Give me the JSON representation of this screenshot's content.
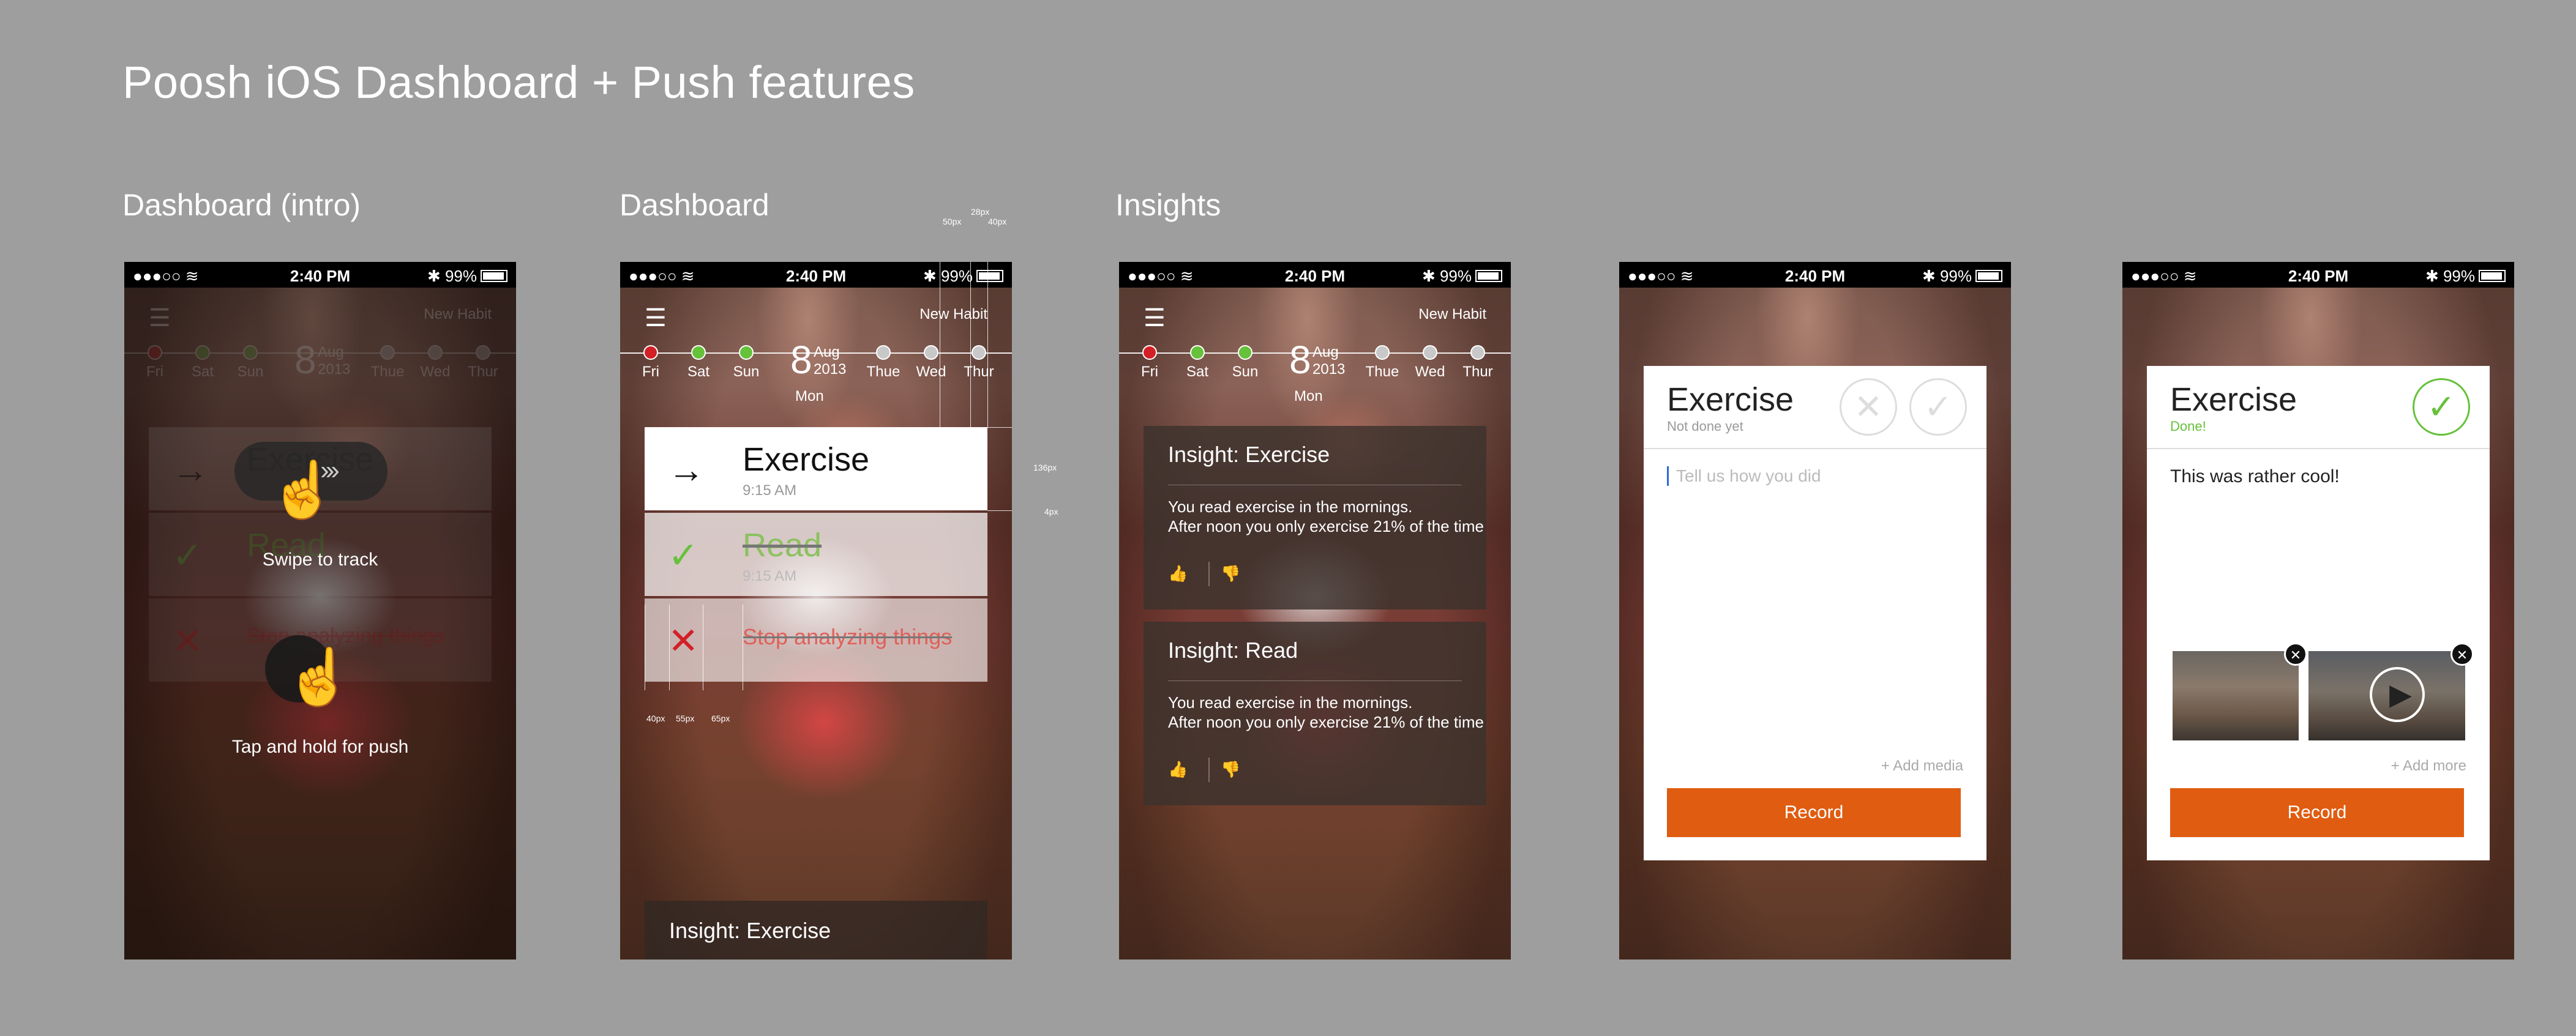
{
  "page": {
    "title": "Poosh iOS Dashboard + Push features"
  },
  "screens": [
    {
      "label": "Dashboard (intro)"
    },
    {
      "label": "Dashboard"
    },
    {
      "label": "Insights"
    },
    {
      "label": ""
    },
    {
      "label": ""
    }
  ],
  "status": {
    "signal": "●●●○○ ≋",
    "time": "2:40 PM",
    "battery": "✱ 99%"
  },
  "nav": {
    "new_habit": "New Habit",
    "menu_icon": "hamburger-icon"
  },
  "days": {
    "items": [
      {
        "name": "Fri",
        "state": "red"
      },
      {
        "name": "Sat",
        "state": "green"
      },
      {
        "name": "Sun",
        "state": "green"
      },
      {
        "name": "Thue",
        "state": "grey"
      },
      {
        "name": "Wed",
        "state": "grey"
      },
      {
        "name": "Thur",
        "state": "grey"
      }
    ],
    "date_num": "8",
    "date_month": "Aug",
    "date_year": "2013",
    "date_weekday": "Mon"
  },
  "habits": [
    {
      "name": "Exercise",
      "time": "9:15 AM",
      "icon": "arrow-right-icon"
    },
    {
      "name": "Read",
      "time": "9:15 AM",
      "icon": "check-icon"
    },
    {
      "name": "Stop analyzing things",
      "time": "",
      "icon": "cross-icon"
    }
  ],
  "intro": {
    "swipe": "Swipe to track",
    "tap": "Tap and hold for push"
  },
  "dashboard": {
    "insight_bar": "Insight: Exercise"
  },
  "measurements": {
    "m1": "50px",
    "m2": "28px",
    "m3": "40px",
    "m4": "136px",
    "m5": "4px",
    "m6": "40px",
    "m7": "55px",
    "m8": "65px"
  },
  "insights": [
    {
      "title": "Insight: Exercise",
      "line1": "You read exercise in the mornings.",
      "line2": "After noon you only exercise 21% of the time"
    },
    {
      "title": "Insight: Read",
      "line1": "You read exercise in the mornings.",
      "line2": "After noon you only exercise 21% of the time"
    }
  ],
  "track": {
    "title": "Exercise",
    "subtitle": "Not done yet",
    "placeholder": "Tell us how you did",
    "add_media": "+ Add media",
    "record": "Record"
  },
  "done": {
    "title": "Exercise",
    "subtitle": "Done!",
    "note": "This was rather cool!",
    "add_more": "+ Add more",
    "record": "Record"
  },
  "colors": {
    "accent": "#e05c10",
    "done_green": "#66c13b",
    "red": "#d32027"
  }
}
